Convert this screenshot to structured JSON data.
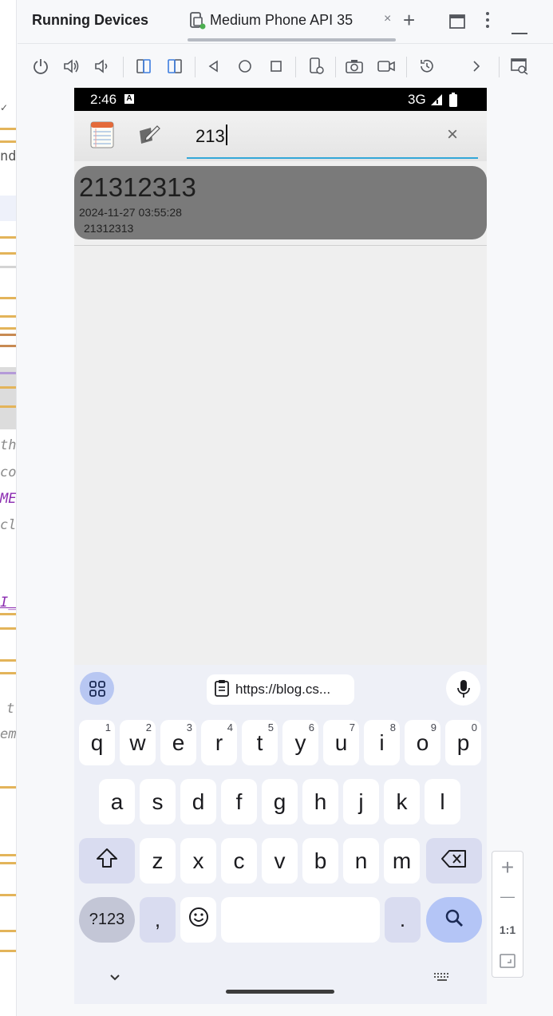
{
  "ide": {
    "panel_title": "Running Devices",
    "device_tab_label": "Medium Phone API 35",
    "device_tab_close": "×",
    "add_tab": "+",
    "code_fragments": [
      "nd",
      "the",
      "co",
      "ME_",
      "cl",
      "I_I",
      "t",
      "em"
    ]
  },
  "zoom": {
    "plus": "+",
    "minus": "—",
    "actual": "1:1"
  },
  "status_bar": {
    "time": "2:46",
    "a_badge": "A",
    "network": "3G"
  },
  "search": {
    "query": "213",
    "clear": "×"
  },
  "note": {
    "title": "21312313",
    "date": "2024-11-27 03:55:28",
    "body": "21312313"
  },
  "keyboard": {
    "clipboard_text": "https://blog.cs...",
    "row1": [
      {
        "key": "q",
        "hint": "1"
      },
      {
        "key": "w",
        "hint": "2"
      },
      {
        "key": "e",
        "hint": "3"
      },
      {
        "key": "r",
        "hint": "4"
      },
      {
        "key": "t",
        "hint": "5"
      },
      {
        "key": "y",
        "hint": "6"
      },
      {
        "key": "u",
        "hint": "7"
      },
      {
        "key": "i",
        "hint": "8"
      },
      {
        "key": "o",
        "hint": "9"
      },
      {
        "key": "p",
        "hint": "0"
      }
    ],
    "row2": [
      "a",
      "s",
      "d",
      "f",
      "g",
      "h",
      "j",
      "k",
      "l"
    ],
    "row3": [
      "z",
      "x",
      "c",
      "v",
      "b",
      "n",
      "m"
    ],
    "sym_label": "?123",
    "comma": ",",
    "period": "."
  }
}
